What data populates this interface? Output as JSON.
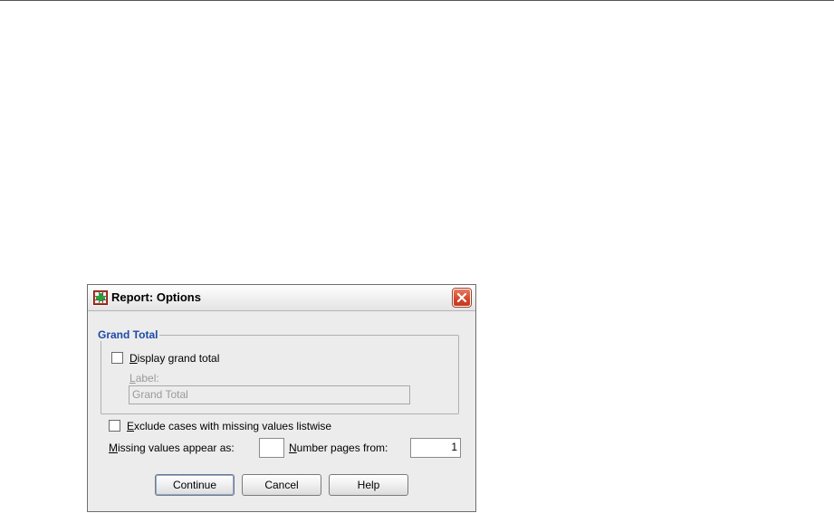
{
  "dialog": {
    "title": "Report: Options",
    "close_icon": "close-icon"
  },
  "grand_total": {
    "legend": "Grand Total",
    "display_checkbox_label_underlined": "D",
    "display_checkbox_label_rest": "isplay grand total",
    "display_checked": false,
    "label_caption_underlined": "L",
    "label_caption_rest": "abel:",
    "label_value": "Grand Total"
  },
  "options": {
    "exclude_label_underlined": "E",
    "exclude_label_rest": "xclude cases with missing values listwise",
    "exclude_checked": false,
    "missing_label_underlined": "M",
    "missing_label_rest": "issing values appear as:",
    "missing_value": "",
    "number_pages_label_underlined": "N",
    "number_pages_label_rest": "umber pages from:",
    "number_pages_value": "1"
  },
  "buttons": {
    "continue": "Continue",
    "cancel": "Cancel",
    "help": "Help"
  }
}
